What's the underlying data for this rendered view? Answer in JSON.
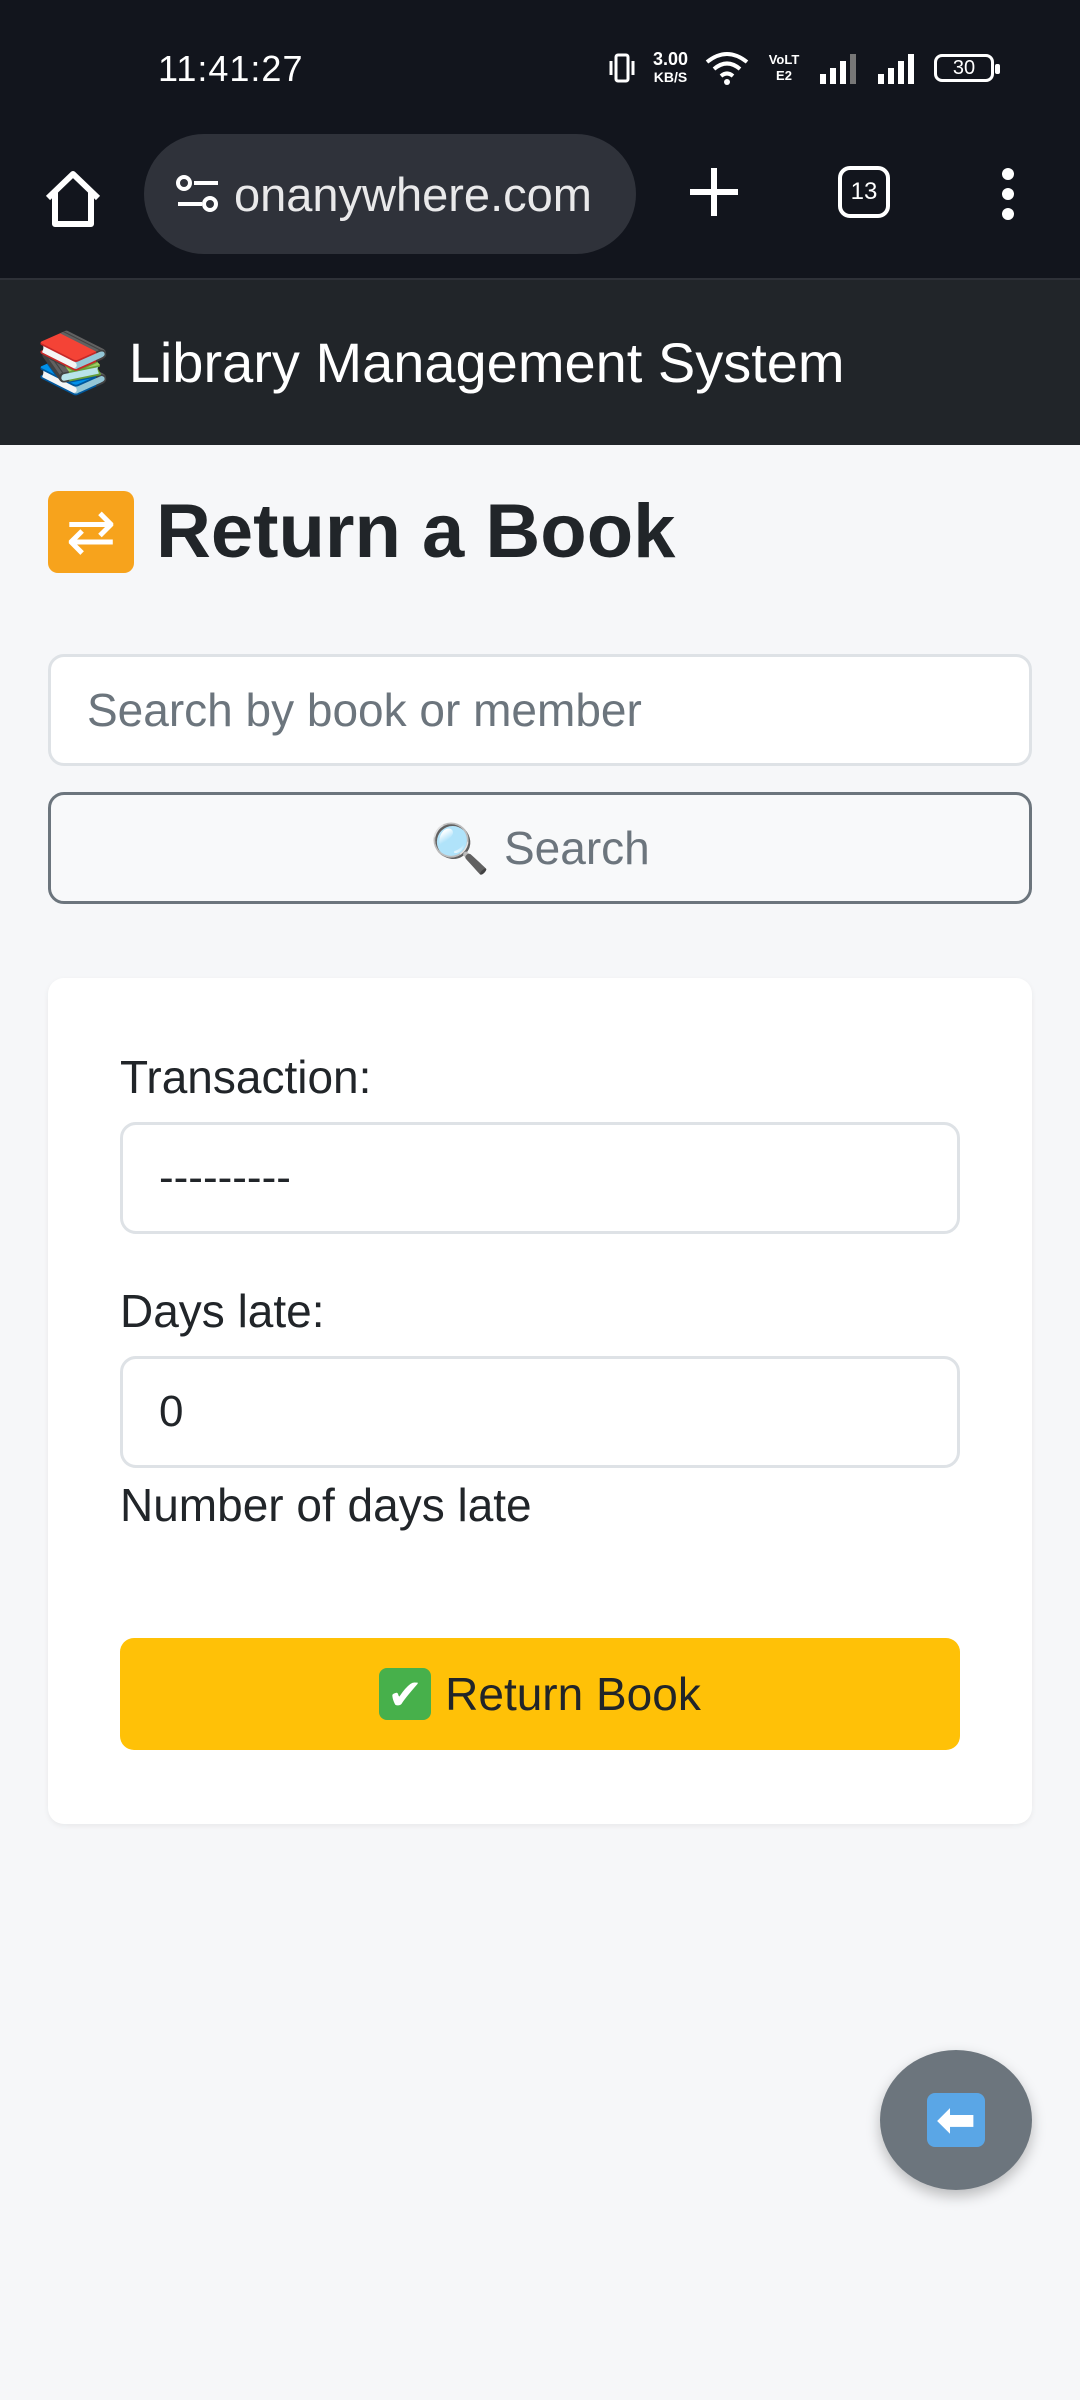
{
  "status_bar": {
    "time": "11:41:27",
    "net_speed_value": "3.00",
    "net_speed_unit": "KB/S",
    "volte": "VoLTE2",
    "battery": "30"
  },
  "browser": {
    "url": "onanywhere.com",
    "tab_count": "13"
  },
  "app": {
    "header_emoji": "📚",
    "title": "Library Management System"
  },
  "page": {
    "title_icon": "🔁",
    "title": "Return a Book",
    "search": {
      "placeholder": "Search by book or member",
      "value": "",
      "button_icon": "🔍",
      "button_label": "Search"
    },
    "form": {
      "transaction_label": "Transaction:",
      "transaction_value": "---------",
      "days_late_label": "Days late:",
      "days_late_value": "0",
      "days_late_help": "Number of days late",
      "submit_icon": "✔",
      "submit_label": "Return Book"
    },
    "back_button_icon": "⬅"
  },
  "colors": {
    "header_bg": "#212529",
    "accent_warning": "#ffc107",
    "secondary": "#6c757d",
    "page_bg": "#f6f7f9"
  }
}
